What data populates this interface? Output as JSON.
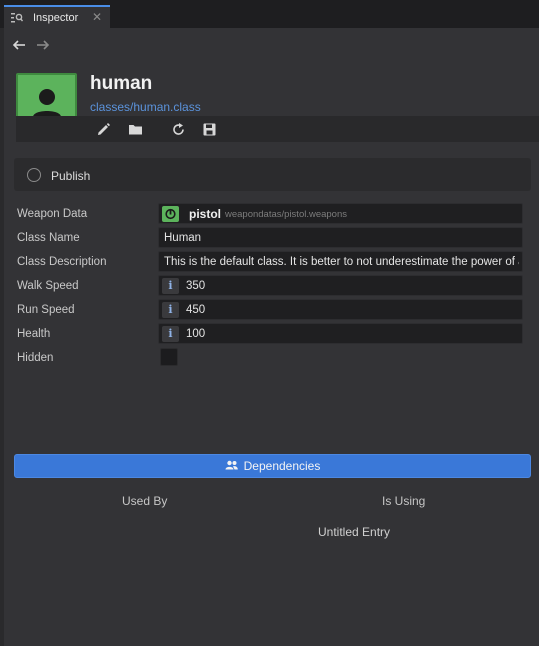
{
  "tab": {
    "label": "Inspector",
    "close": "✕"
  },
  "header": {
    "title": "human",
    "path": "classes/human.class"
  },
  "publish": {
    "label": "Publish"
  },
  "properties": {
    "weapon_data": {
      "label": "Weapon Data",
      "name": "pistol",
      "path": "weapondatas/pistol.weapons"
    },
    "class_name": {
      "label": "Class Name",
      "value": "Human"
    },
    "class_description": {
      "label": "Class Description",
      "value": "This is the default class. It is better to not underestimate the power of a p"
    },
    "walk_speed": {
      "label": "Walk Speed",
      "badge": "i",
      "value": "350"
    },
    "run_speed": {
      "label": "Run Speed",
      "badge": "i",
      "value": "450"
    },
    "health": {
      "label": "Health",
      "badge": "i",
      "value": "100"
    },
    "hidden": {
      "label": "Hidden",
      "checked": false
    }
  },
  "dependencies": {
    "button_label": "Dependencies",
    "used_by": "Used By",
    "is_using": "Is Using",
    "entries": [
      "Untitled Entry"
    ]
  },
  "colors": {
    "accent": "#3a78d8",
    "avatar": "#5cb35c",
    "link": "#5b93dc"
  }
}
